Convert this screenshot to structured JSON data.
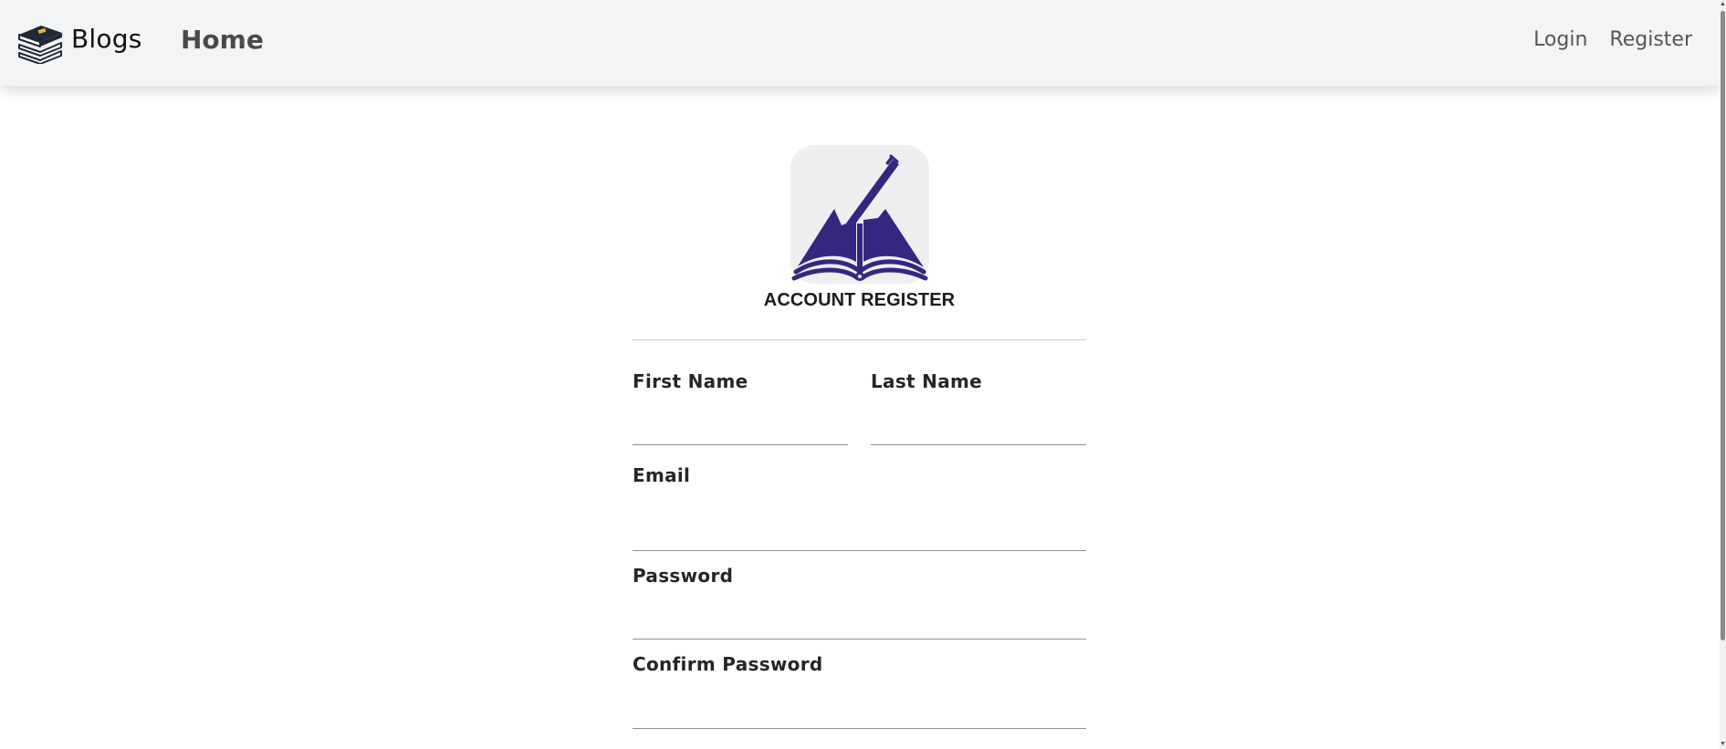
{
  "navbar": {
    "brand_name": "Blogs",
    "brand_icon": "book-stack-icon",
    "home_label": "Home",
    "links": [
      {
        "label": "Login"
      },
      {
        "label": "Register"
      }
    ]
  },
  "register_form": {
    "logo_icon": "book-and-pen-icon",
    "title": "ACCOUNT REGISTER",
    "fields": {
      "first_name": {
        "label": "First Name",
        "value": ""
      },
      "last_name": {
        "label": "Last Name",
        "value": ""
      },
      "email": {
        "label": "Email",
        "value": ""
      },
      "password": {
        "label": "Password",
        "value": ""
      },
      "confirm_password": {
        "label": "Confirm Password",
        "value": ""
      }
    }
  },
  "colors": {
    "navbar_bg": "#f3f4f6",
    "logo_purple": "#35267f",
    "book_cover": "#1f2937",
    "bookmark": "#f0b429"
  }
}
